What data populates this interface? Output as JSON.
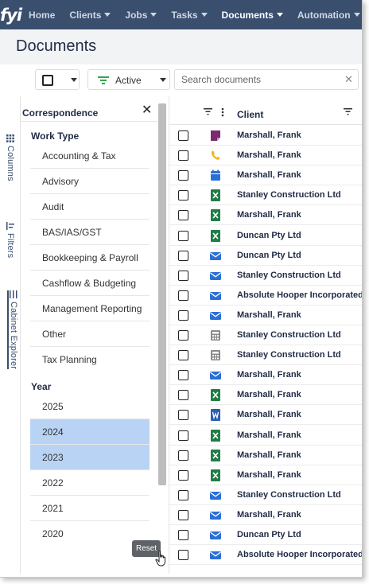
{
  "nav": {
    "logo": "fyi",
    "items": [
      {
        "label": "Home",
        "dropdown": false,
        "active": false
      },
      {
        "label": "Clients",
        "dropdown": true,
        "active": false
      },
      {
        "label": "Jobs",
        "dropdown": true,
        "active": false
      },
      {
        "label": "Tasks",
        "dropdown": true,
        "active": false
      },
      {
        "label": "Documents",
        "dropdown": true,
        "active": true
      },
      {
        "label": "Automation",
        "dropdown": true,
        "active": false
      }
    ]
  },
  "page": {
    "title": "Documents"
  },
  "toolbar": {
    "filter_label": "Active",
    "search_placeholder": "Search documents",
    "clear_icon": "close-icon"
  },
  "side_tabs": [
    {
      "label": "Columns",
      "icon": "columns-icon"
    },
    {
      "label": "Filters",
      "icon": "filters-icon"
    },
    {
      "label": "Cabinet Explorer",
      "icon": "cabinet-icon",
      "selected": true
    }
  ],
  "panel": {
    "title": "Correspondence",
    "work_type_heading": "Work Type",
    "work_types": [
      "Accounting & Tax",
      "Advisory",
      "Audit",
      "BAS/IAS/GST",
      "Bookkeeping & Payroll",
      "Cashflow & Budgeting",
      "Management Reporting",
      "Other",
      "Tax Planning"
    ],
    "year_heading": "Year",
    "years": [
      {
        "label": "2025",
        "selected": false
      },
      {
        "label": "2024",
        "selected": true
      },
      {
        "label": "2023",
        "selected": true
      },
      {
        "label": "2022",
        "selected": false
      },
      {
        "label": "2021",
        "selected": false
      },
      {
        "label": "2020",
        "selected": false
      }
    ],
    "reset_label": "Reset"
  },
  "table": {
    "column_header": "Client",
    "rows": [
      {
        "icon": "note-icon",
        "client": "Marshall, Frank"
      },
      {
        "icon": "phone-icon",
        "client": "Marshall, Frank"
      },
      {
        "icon": "calendar-icon",
        "client": "Marshall, Frank"
      },
      {
        "icon": "excel-icon",
        "client": "Stanley Construction Ltd"
      },
      {
        "icon": "excel-icon",
        "client": "Marshall, Frank"
      },
      {
        "icon": "excel-icon",
        "client": "Duncan Pty Ltd"
      },
      {
        "icon": "email-icon",
        "client": "Duncan Pty Ltd"
      },
      {
        "icon": "email-icon",
        "client": "Stanley Construction Ltd"
      },
      {
        "icon": "email-icon",
        "client": "Absolute Hooper Incorporated"
      },
      {
        "icon": "email-icon",
        "client": "Marshall, Frank"
      },
      {
        "icon": "calculator-icon",
        "client": "Stanley Construction Ltd"
      },
      {
        "icon": "calculator-icon",
        "client": "Stanley Construction Ltd"
      },
      {
        "icon": "email-icon",
        "client": "Marshall, Frank"
      },
      {
        "icon": "excel-icon",
        "client": "Marshall, Frank"
      },
      {
        "icon": "word-icon",
        "client": "Marshall, Frank"
      },
      {
        "icon": "excel-icon",
        "client": "Marshall, Frank"
      },
      {
        "icon": "excel-icon",
        "client": "Marshall, Frank"
      },
      {
        "icon": "excel-icon",
        "client": "Marshall, Frank"
      },
      {
        "icon": "email-icon",
        "client": "Stanley Construction Ltd"
      },
      {
        "icon": "email-icon",
        "client": "Marshall, Frank"
      },
      {
        "icon": "email-icon",
        "client": "Duncan Pty Ltd"
      },
      {
        "icon": "email-icon",
        "client": "Absolute Hooper Incorporated"
      }
    ]
  },
  "colors": {
    "nav_bg": "#3a4f6e",
    "selected_bg": "#b9d3f4",
    "email": "#2b6fd6",
    "excel": "#1e7e45",
    "word": "#2b5fb0",
    "phone": "#f2b705",
    "note": "#7a2d6e",
    "calendar": "#2b6fd6",
    "calculator": "#8a8a8a"
  }
}
